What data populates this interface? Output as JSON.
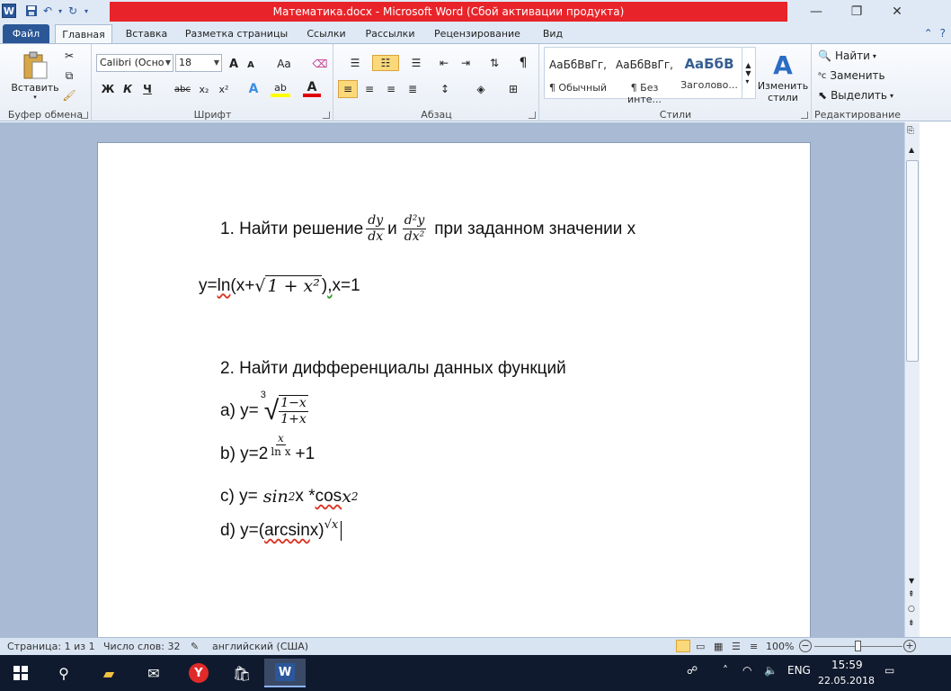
{
  "window": {
    "title": "Математика.docx - Microsoft Word (Сбой активации продукта)",
    "app_icon": "W"
  },
  "tabs": [
    "Файл",
    "Главная",
    "Вставка",
    "Разметка страницы",
    "Ссылки",
    "Рассылки",
    "Рецензирование",
    "Вид"
  ],
  "ribbon": {
    "clipboard": {
      "paste_label": "Вставить",
      "group_label": "Буфер обмена"
    },
    "font": {
      "font_name": "Calibri (Осно",
      "font_size": "18",
      "group_label": "Шрифт",
      "bold": "Ж",
      "italic": "К",
      "underline": "Ч",
      "strike": "abc",
      "subscript": "x₂",
      "superscript": "x²",
      "grow": "A",
      "shrink": "A",
      "case": "Aa"
    },
    "paragraph": {
      "group_label": "Абзац",
      "pilcrow": "¶"
    },
    "styles": {
      "group_label": "Стили",
      "items": [
        {
          "sample": "АаБбВвГг,",
          "name": "¶ Обычный"
        },
        {
          "sample": "АаБбВвГг,",
          "name": "¶ Без инте..."
        },
        {
          "sample": "АаБбВ",
          "name": "Заголово..."
        }
      ],
      "change_styles": "Изменить стили"
    },
    "editing": {
      "group_label": "Редактирование",
      "find": "Найти",
      "replace": "Заменить",
      "select": "Выделить"
    }
  },
  "document": {
    "task1_text": "1. Найти решение",
    "task1_and": "и",
    "task1_tail": "при заданном значении x",
    "frac1_num": "dy",
    "frac1_den": "dx",
    "frac2_num": "d²y",
    "frac2_den": "dx²",
    "eq1_prefix": "y=",
    "eq1_ln": "ln",
    "eq1_open": "(x+",
    "eq1_sqrt": "1 + x²",
    "eq1_close": ")",
    "eq1_comma": " ,",
    "eq1_tail": " x=1",
    "task2_text": "2. Найти дифференциалы данных функций",
    "a_label": "a) y=",
    "a_root_index": "3",
    "a_num": "1−x",
    "a_den": "1+x",
    "b_label": "b) y=2",
    "b_exp_num": "x",
    "b_exp_den": "ln x",
    "b_tail": "+1",
    "c_label": "c) y=",
    "c_sin": "sin",
    "c_sin_exp": "2",
    "c_mid": "x * ",
    "c_cos": "cos",
    "c_x": " x",
    "c_x_exp": "2",
    "d_label": "d) y=(",
    "d_arcsin": "arcsin",
    "d_mid": " x)",
    "d_exp": "√x"
  },
  "status": {
    "page": "Страница: 1 из 1",
    "words": "Число слов: 32",
    "lang": "английский (США)",
    "zoom": "100%"
  },
  "taskbar": {
    "lang": "ENG",
    "time": "15:59",
    "date": "22.05.2018"
  },
  "colors": {
    "title_red": "#e8242a",
    "word_blue": "#2b579a",
    "taskbar": "#101a2e"
  }
}
